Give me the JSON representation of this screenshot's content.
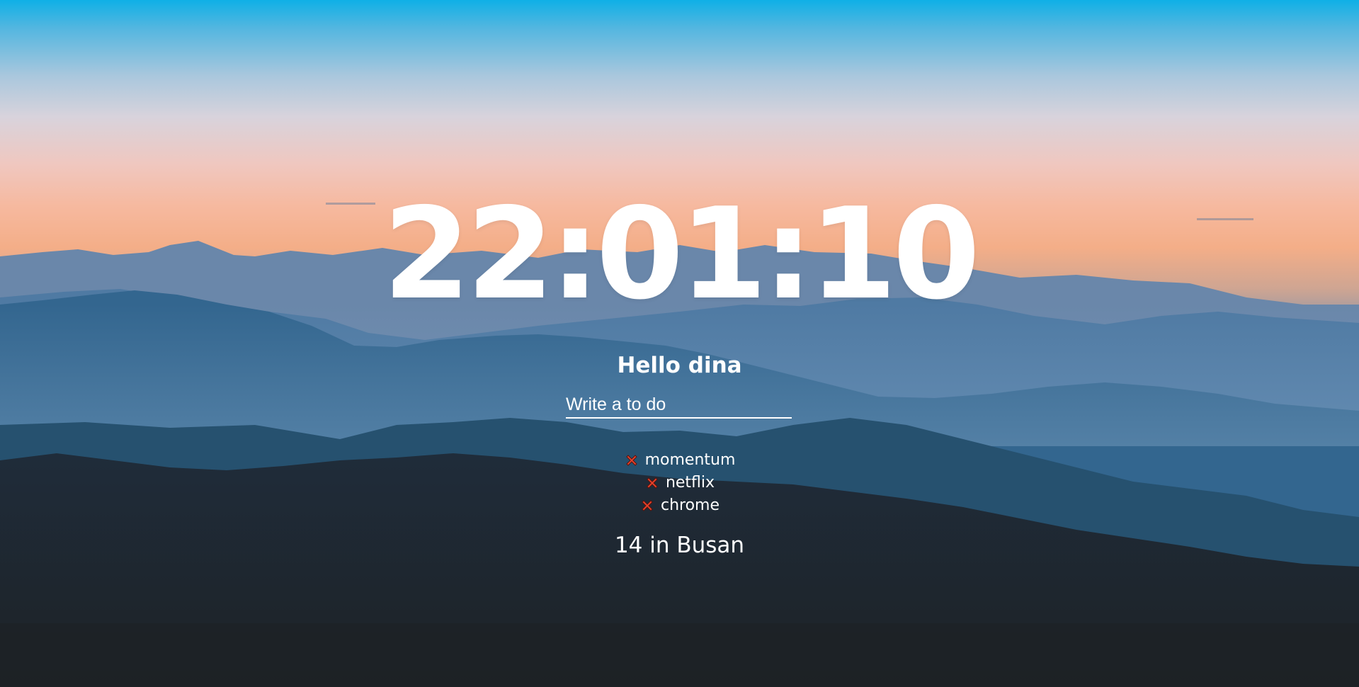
{
  "clock": {
    "time": "22:01:10"
  },
  "greeting": {
    "text": "Hello dina"
  },
  "todo": {
    "placeholder": "Write a to do",
    "items": [
      {
        "label": "momentum",
        "delete_icon": "x-icon"
      },
      {
        "label": "netflix",
        "delete_icon": "x-icon"
      },
      {
        "label": "chrome",
        "delete_icon": "x-icon"
      }
    ]
  },
  "weather": {
    "text": "14 in Busan"
  },
  "colors": {
    "delete_icon_fill": "#e8432c",
    "delete_icon_stroke": "#5a140d",
    "text": "#ffffff"
  }
}
